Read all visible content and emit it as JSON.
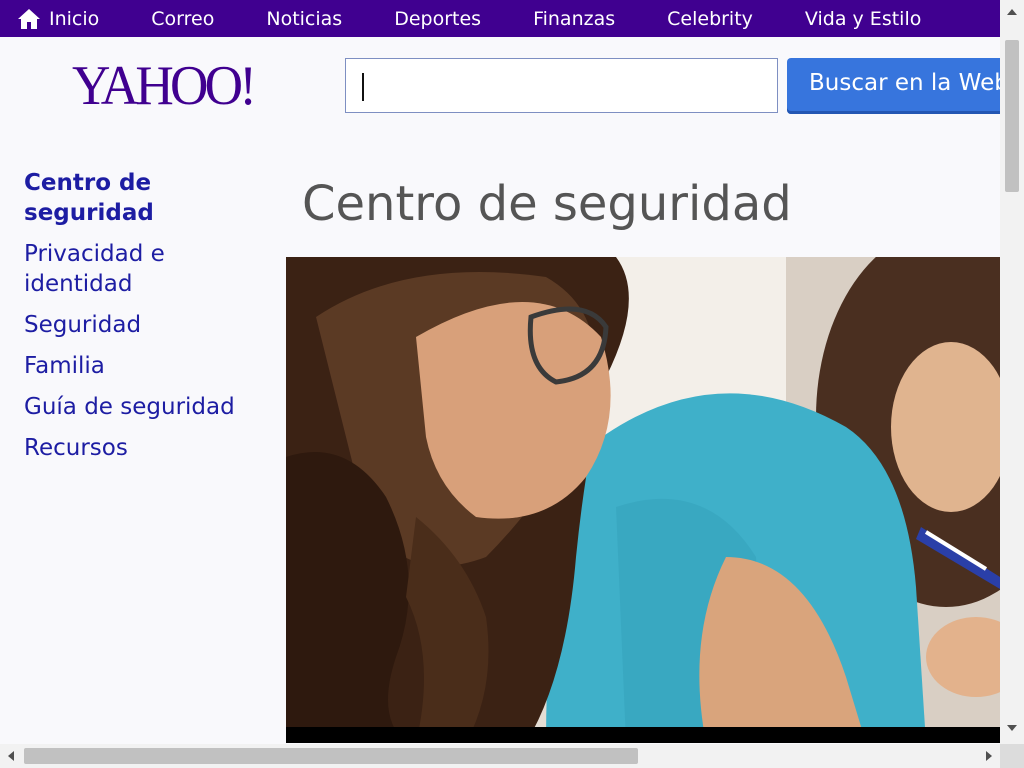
{
  "topnav": {
    "items": [
      {
        "label": "Inicio",
        "icon": "home-icon"
      },
      {
        "label": "Correo"
      },
      {
        "label": "Noticias"
      },
      {
        "label": "Deportes"
      },
      {
        "label": "Finanzas"
      },
      {
        "label": "Celebrity"
      },
      {
        "label": "Vida y Estilo"
      }
    ]
  },
  "logo": {
    "text": "YAHOO!",
    "color": "#400090"
  },
  "search": {
    "value": "",
    "button_label": "Buscar en la Web"
  },
  "sidebar": {
    "items": [
      {
        "label": "Centro de seguridad",
        "active": true
      },
      {
        "label": "Privacidad e identidad"
      },
      {
        "label": "Seguridad"
      },
      {
        "label": "Familia"
      },
      {
        "label": "Guía de seguridad"
      },
      {
        "label": "Recursos"
      }
    ]
  },
  "main": {
    "title": "Centro de seguridad",
    "hero_image": "mujer-y-nina-escribiendo"
  },
  "colors": {
    "nav_bg": "#400090",
    "link": "#1d1da3",
    "button": "#3775dd",
    "title": "#555555"
  }
}
